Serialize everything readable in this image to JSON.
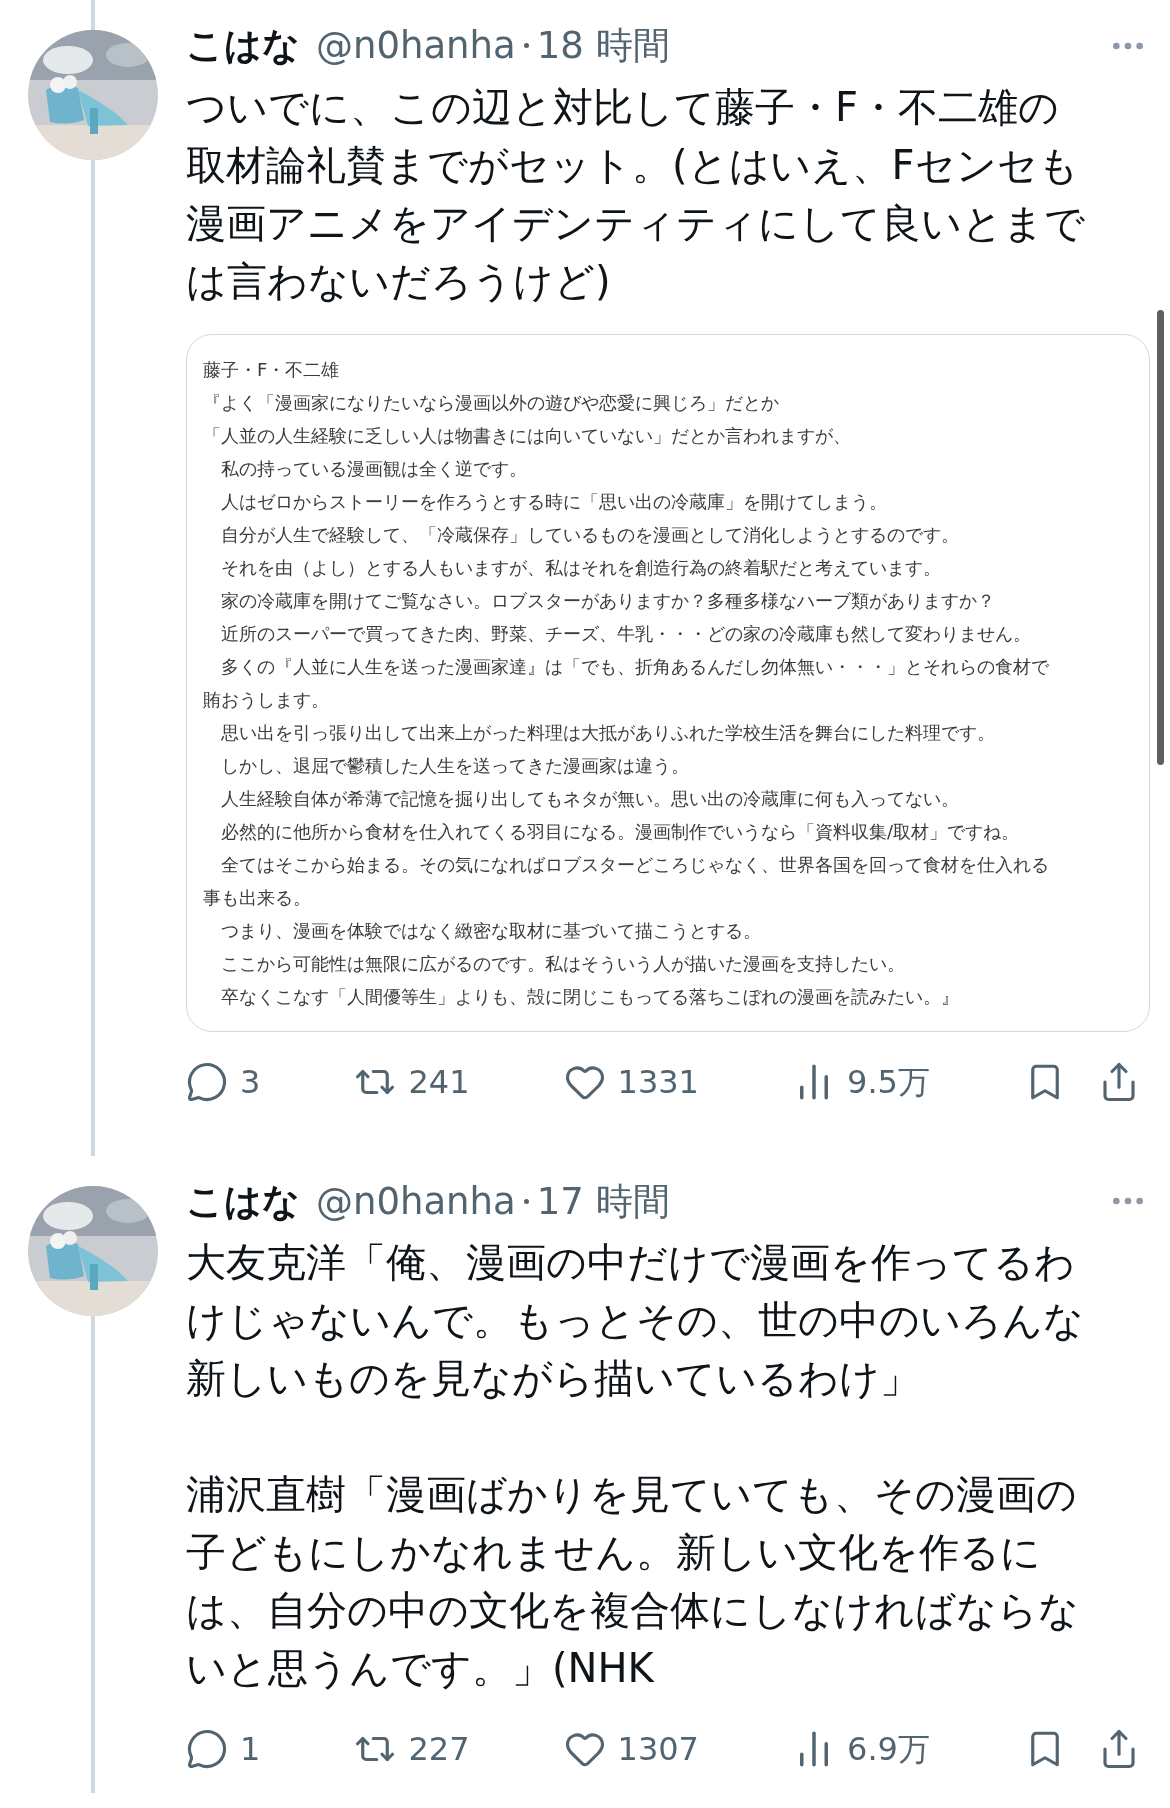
{
  "tweets": [
    {
      "name": "こはな",
      "handle": "@n0hanha",
      "time": "18 時間",
      "paragraphs": [
        [
          "ついでに、この辺と対比して藤子・F・不二雄の",
          "取材論礼賛までがセット。(とはいえ、Fセンセも",
          "漫画アニメをアイデンティティにして良いとまで",
          "は言わないだろうけど)"
        ]
      ],
      "thread_above": true,
      "attachment": {
        "kind": "text_image",
        "lines": [
          "藤子・F・不二雄",
          "『よく「漫画家になりたいなら漫画以外の遊びや恋愛に興じろ」だとか",
          "「人並の人生経験に乏しい人は物書きには向いていない」だとか言われますが、",
          "　私の持っている漫画観は全く逆です。",
          "　人はゼロからストーリーを作ろうとする時に「思い出の冷蔵庫」を開けてしまう。",
          "　自分が人生で経験して、「冷蔵保存」しているものを漫画として消化しようとするのです。",
          "　それを由（よし）とする人もいますが、私はそれを創造行為の終着駅だと考えています。",
          "　家の冷蔵庫を開けてご覧なさい。ロブスターがありますか？多種多様なハーブ類がありますか？",
          "　近所のスーパーで買ってきた肉、野菜、チーズ、牛乳・・・どの家の冷蔵庫も然して変わりません。",
          "　多くの『人並に人生を送った漫画家達』は「でも、折角あるんだし勿体無い・・・」とそれらの食材で",
          "賄おうします。",
          "　思い出を引っ張り出して出来上がった料理は大抵がありふれた学校生活を舞台にした料理です。",
          "　しかし、退屈で鬱積した人生を送ってきた漫画家は違う。",
          "　人生経験自体が希薄で記憶を掘り出してもネタが無い。思い出の冷蔵庫に何も入ってない。",
          "　必然的に他所から食材を仕入れてくる羽目になる。漫画制作でいうなら「資料収集/取材」ですね。",
          "　全てはそこから始まる。その気になればロブスターどころじゃなく、世界各国を回って食材を仕入れる",
          "事も出来る。",
          "　つまり、漫画を体験ではなく緻密な取材に基づいて描こうとする。",
          "　ここから可能性は無限に広がるのです。私はそういう人が描いた漫画を支持したい。",
          "　卒なくこなす「人間優等生」よりも、殻に閉じこもってる落ちこぼれの漫画を読みたい。』"
        ]
      },
      "stats": {
        "replies": "3",
        "reposts": "241",
        "likes": "1331",
        "views": "9.5万"
      }
    },
    {
      "name": "こはな",
      "handle": "@n0hanha",
      "time": "17 時間",
      "paragraphs": [
        [
          "大友克洋「俺、漫画の中だけで漫画を作ってるわ",
          "けじゃないんで。もっとその、世の中のいろんな",
          "新しいものを見ながら描いているわけ」"
        ],
        [
          "浦沢直樹「漫画ばかりを見ていても、その漫画の",
          "子どもにしかなれません。新しい文化を作るに",
          "は、自分の中の文化を複合体にしなければならな",
          "いと思うんです。」(NHK"
        ]
      ],
      "thread_above": false,
      "stats": {
        "replies": "1",
        "reposts": "227",
        "likes": "1307",
        "views": "6.9万"
      }
    }
  ]
}
